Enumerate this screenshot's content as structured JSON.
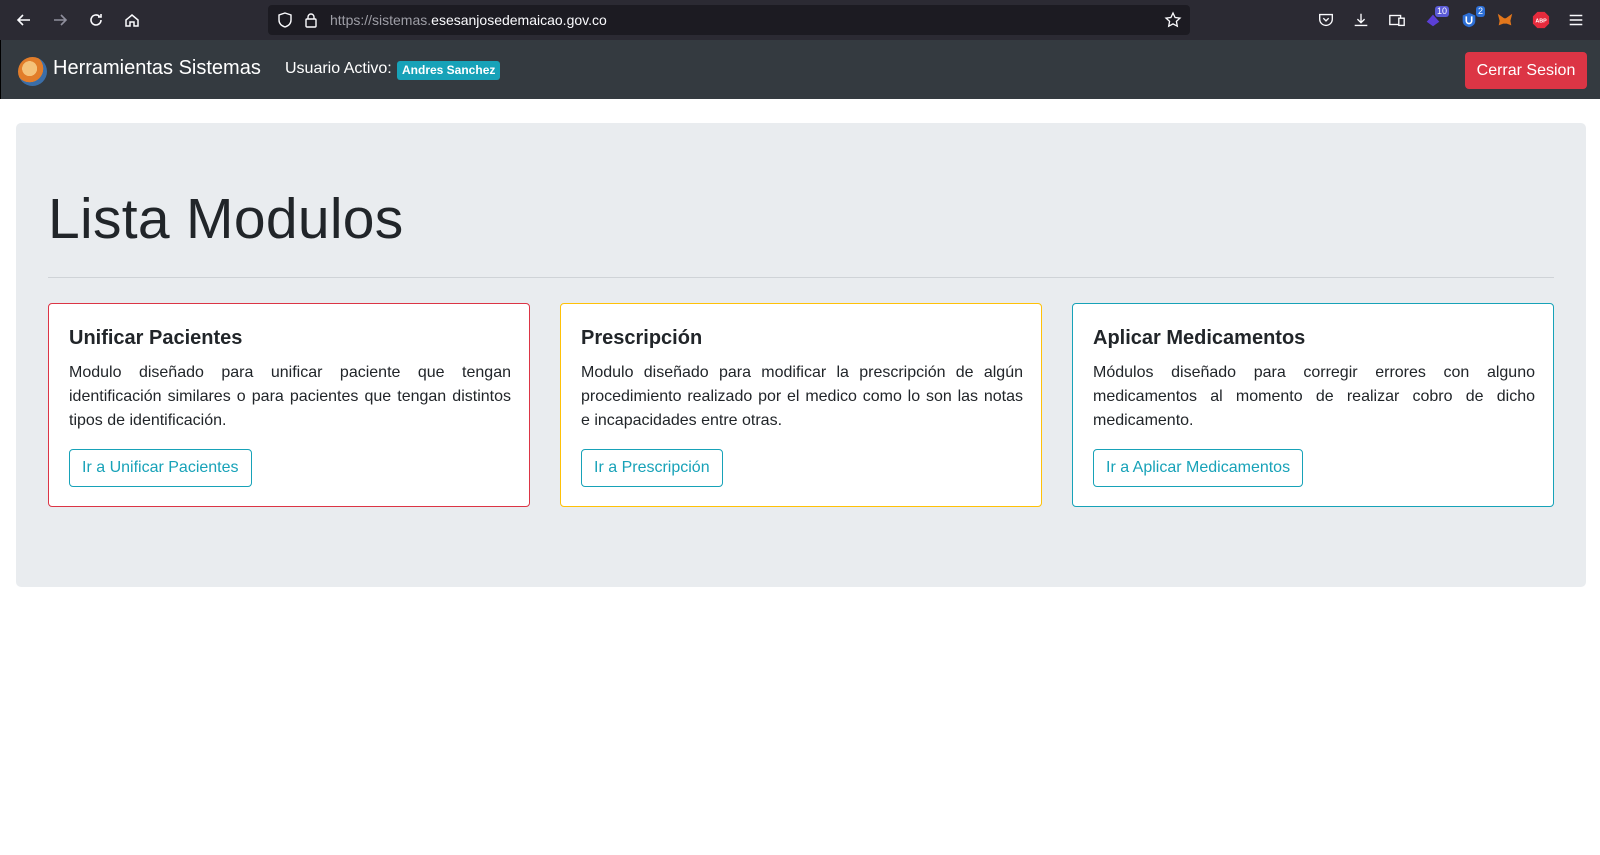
{
  "browser": {
    "url_prefix": "https://sistemas.",
    "url_domain": "esesanjosedemaicao.gov.co",
    "extension_badges": {
      "ext1": "10",
      "ext2": "2"
    },
    "abp_label": "ABP"
  },
  "navbar": {
    "brand": "Herramientas Sistemas",
    "user_label": "Usuario Activo:",
    "user_name": "Andres Sanchez",
    "logout": "Cerrar Sesion"
  },
  "main": {
    "title": "Lista Modulos",
    "cards": [
      {
        "title": "Unificar Pacientes",
        "text": "Modulo diseñado para unificar paciente que tengan identificación similares o para pacientes que tengan distintos tipos de identificación.",
        "button": "Ir a Unificar Pacientes",
        "border_color": "#dc3545"
      },
      {
        "title": "Prescripción",
        "text": "Modulo diseñado para modificar la prescripción de algún procedimiento realizado por el medico como lo son las notas e incapacidades entre otras.",
        "button": "Ir a Prescripción",
        "border_color": "#ffc107"
      },
      {
        "title": "Aplicar Medicamentos",
        "text": "Módulos diseñado para corregir errores con alguno medicamentos al momento de realizar cobro de dicho medicamento.",
        "button": "Ir a Aplicar Medicamentos",
        "border_color": "#17a2b8"
      }
    ]
  }
}
